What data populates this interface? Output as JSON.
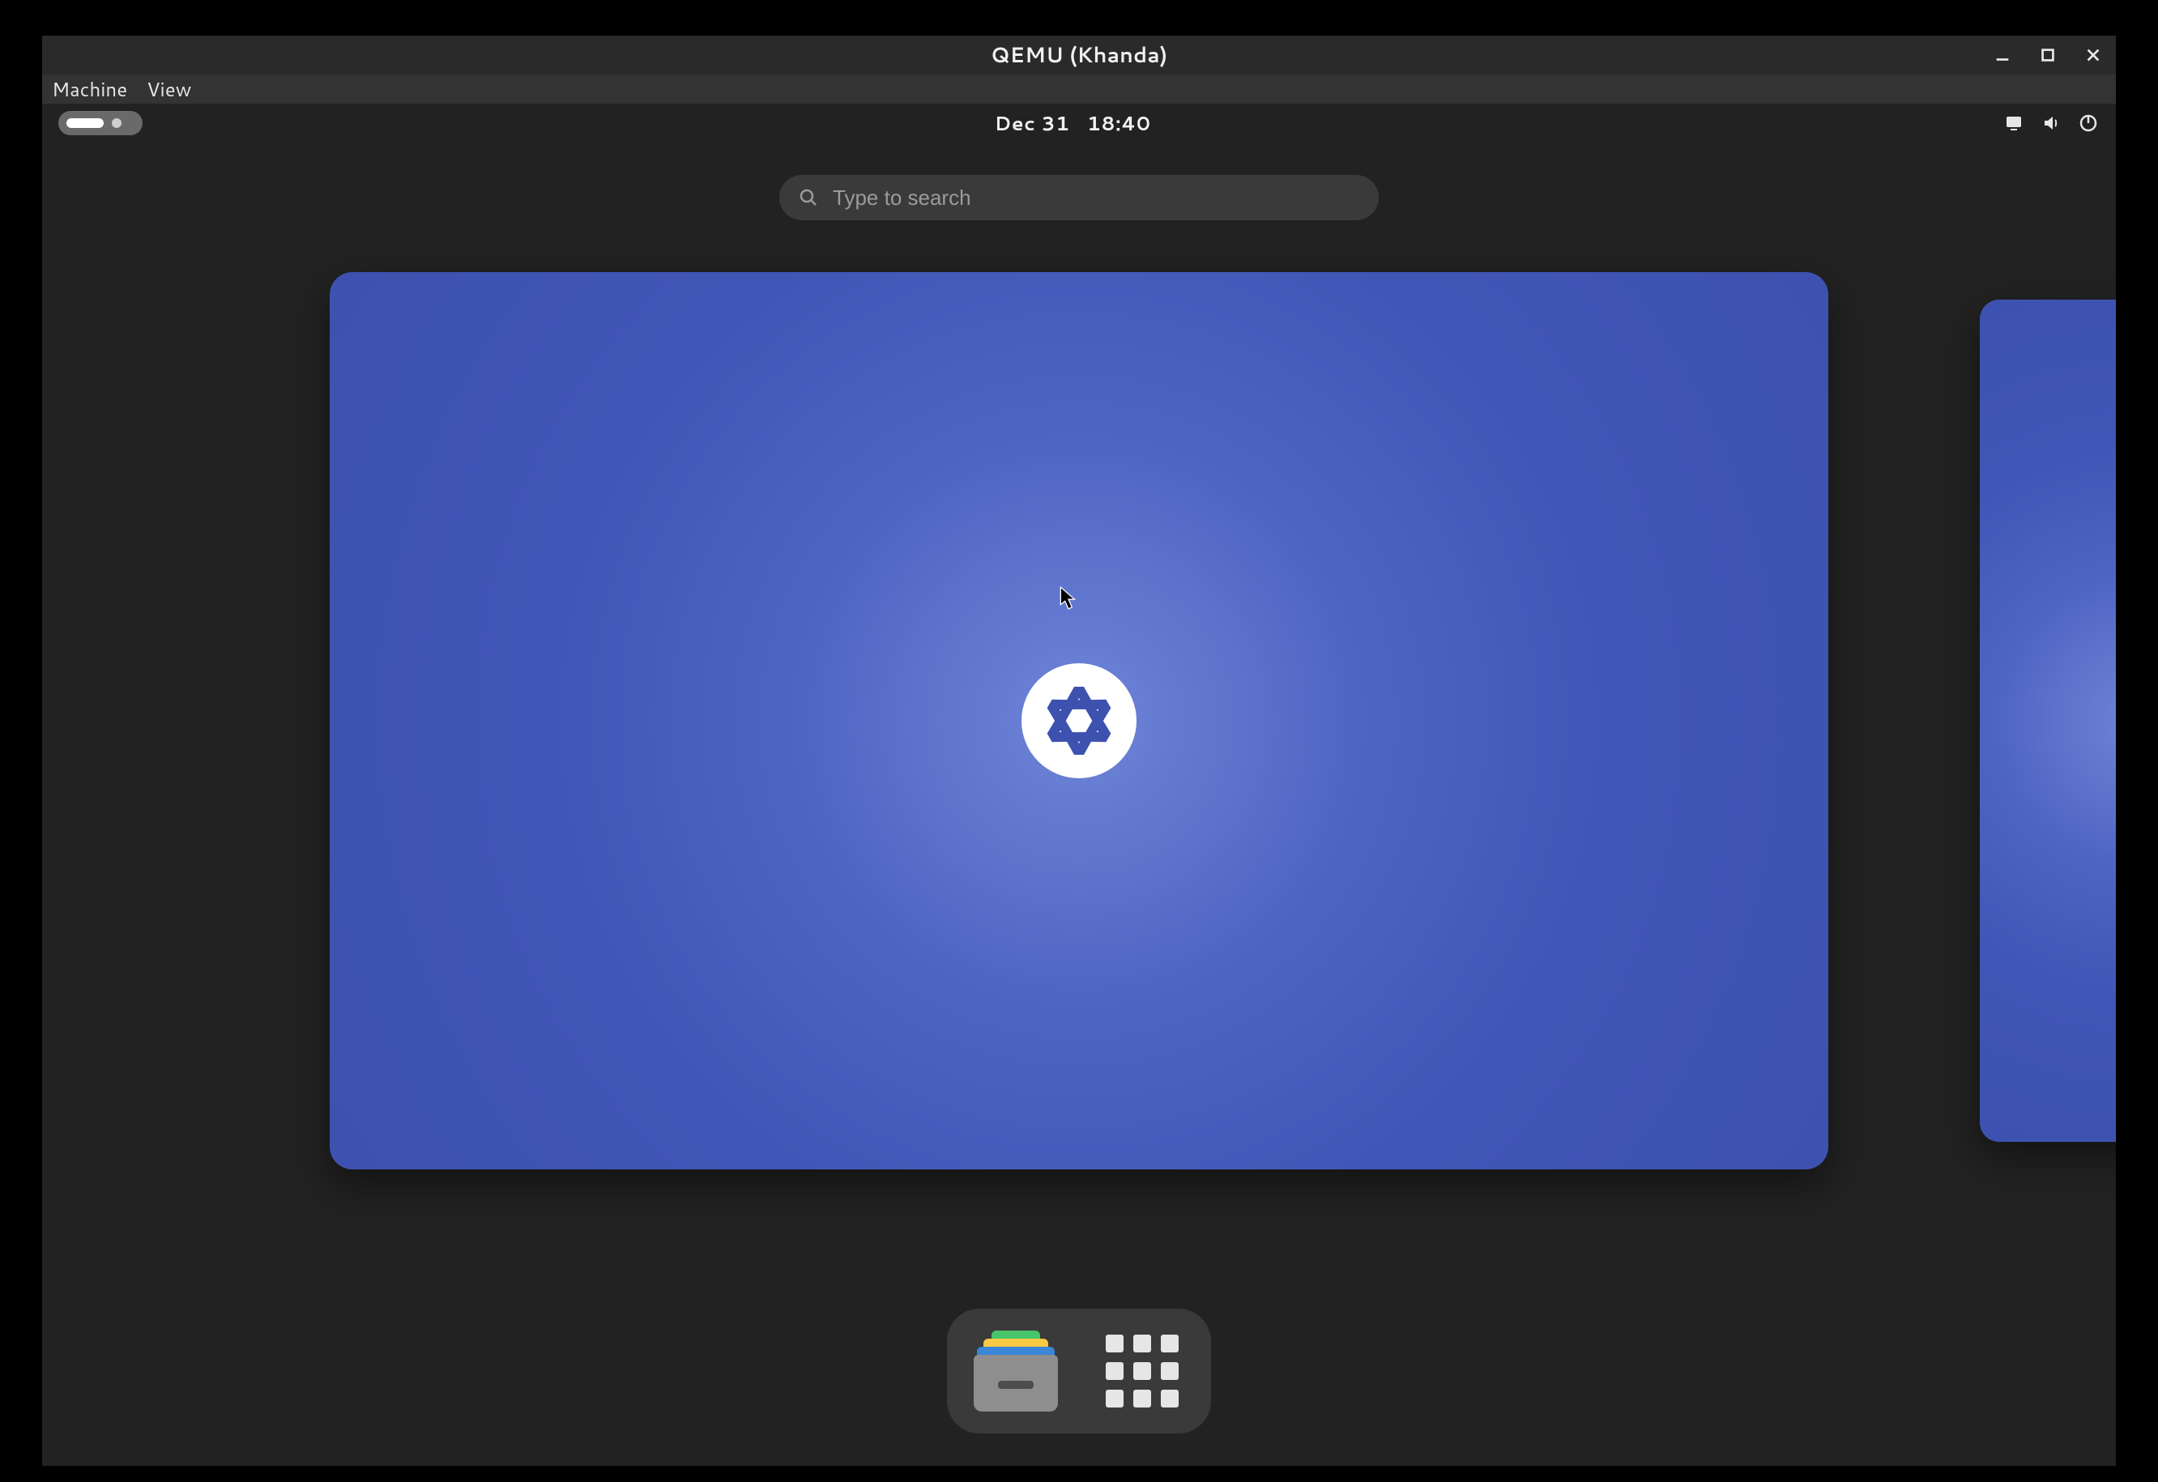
{
  "qemu": {
    "title": "QEMU (Khanda)",
    "menu": {
      "machine": "Machine",
      "view": "View"
    }
  },
  "topbar": {
    "date": "Dec 31",
    "time": "18:40"
  },
  "search": {
    "placeholder": "Type to search"
  },
  "icons": {
    "minimize": "minimize-icon",
    "maximize": "maximize-icon",
    "close": "close-icon",
    "screen": "screen-icon",
    "volume": "volume-icon",
    "power": "power-icon",
    "search": "search-icon",
    "nixos": "nixos-logo",
    "files": "files-icon",
    "appgrid": "app-grid-icon"
  }
}
